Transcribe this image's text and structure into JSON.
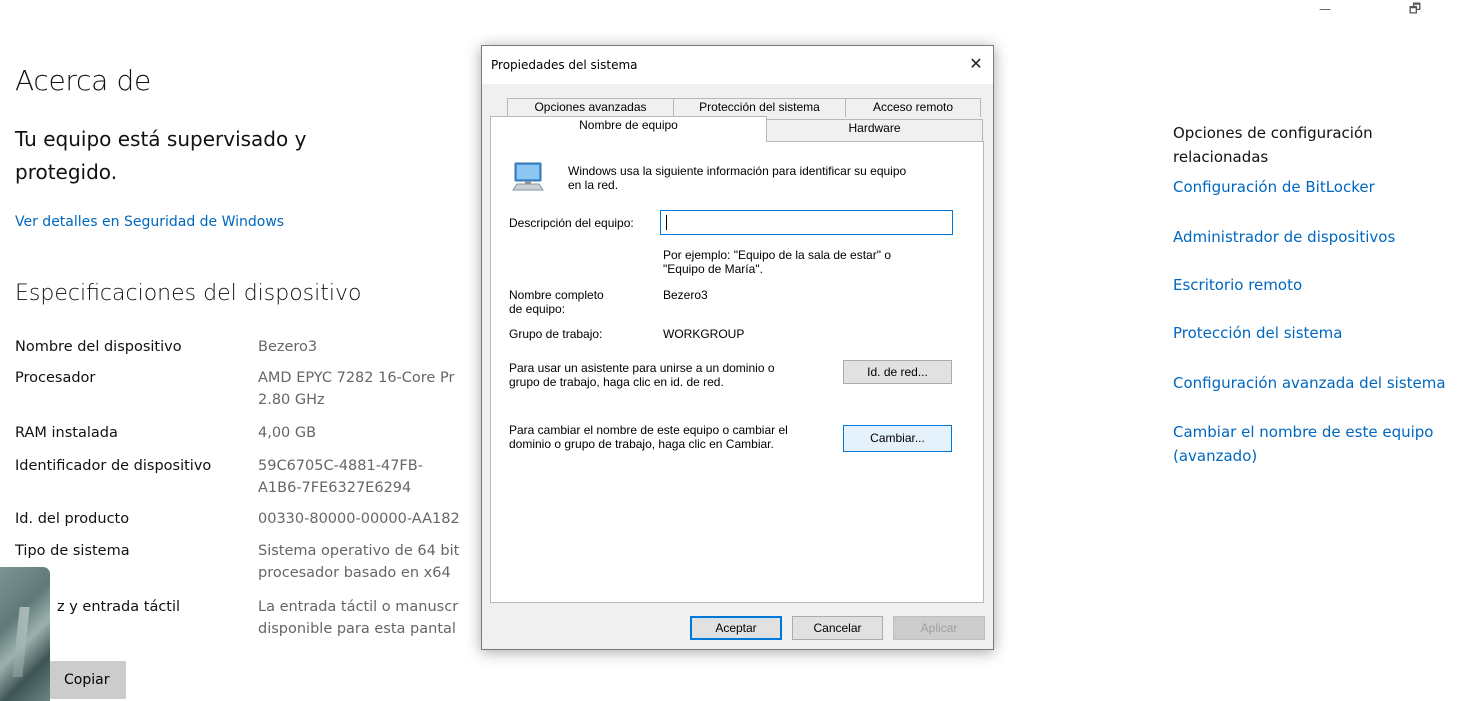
{
  "window": {
    "minimize_glyph": "—",
    "restore_glyph": "🗗"
  },
  "about": {
    "title": "Acerca de",
    "protected_text": "Tu equipo está supervisado y protegido.",
    "security_link": "Ver detalles en Seguridad de Windows",
    "spec_title": "Especificaciones del dispositivo",
    "specs": [
      {
        "label": "Nombre del dispositivo",
        "value": "Bezero3"
      },
      {
        "label": "Procesador",
        "value": "AMD EPYC 7282 16-Core Pr",
        "value2": "2.80 GHz"
      },
      {
        "label": "RAM instalada",
        "value": "4,00 GB"
      },
      {
        "label": "Identificador de dispositivo",
        "value": "59C6705C-4881-47FB-",
        "value2": "A1B6-7FE6327E6294"
      },
      {
        "label": "Id. del producto",
        "value": "00330-80000-00000-AA182"
      },
      {
        "label": "Tipo de sistema",
        "value": "Sistema operativo de 64 bit",
        "value2": "procesador basado en x64"
      },
      {
        "label": "z y entrada táctil",
        "value": "La entrada táctil o manuscr",
        "value2": "disponible para esta pantal"
      }
    ],
    "copy_button": "Copiar"
  },
  "related": {
    "header": "Opciones de configuración relacionadas",
    "links": [
      "Configuración de BitLocker",
      "Administrador de dispositivos",
      "Escritorio remoto",
      "Protección del sistema",
      "Configuración avanzada del sistema",
      "Cambiar el nombre de este equipo (avanzado)"
    ]
  },
  "dialog": {
    "title": "Propiedades del sistema",
    "close_glyph": "✕",
    "tabs_row1": [
      "Opciones avanzadas",
      "Protección del sistema",
      "Acceso remoto"
    ],
    "tabs_row2": [
      "Nombre de equipo",
      "Hardware"
    ],
    "active_tab": "Nombre de equipo",
    "intro": "Windows usa la siguiente información para identificar su equipo",
    "intro2": "en la red.",
    "desc_label": "Descripción del equipo:",
    "desc_value": "",
    "example_line1": "Por ejemplo: \"Equipo de la sala de estar\" o",
    "example_line2": "\"Equipo de María\".",
    "fullname_label1": "Nombre completo",
    "fullname_label2": "de equipo:",
    "fullname_value": "Bezero3",
    "workgroup_label": "Grupo de trabajo:",
    "workgroup_value": "WORKGROUP",
    "netid_text1": "Para usar un asistente para unirse a un dominio o",
    "netid_text2": "grupo de trabajo, haga clic en id. de red.",
    "netid_button": "Id. de red...",
    "change_text1": "Para cambiar el nombre de este equipo o cambiar el",
    "change_text2": "dominio o grupo de trabajo, haga clic en Cambiar.",
    "change_button": "Cambiar...",
    "ok_button": "Aceptar",
    "cancel_button": "Cancelar",
    "apply_button": "Aplicar"
  }
}
